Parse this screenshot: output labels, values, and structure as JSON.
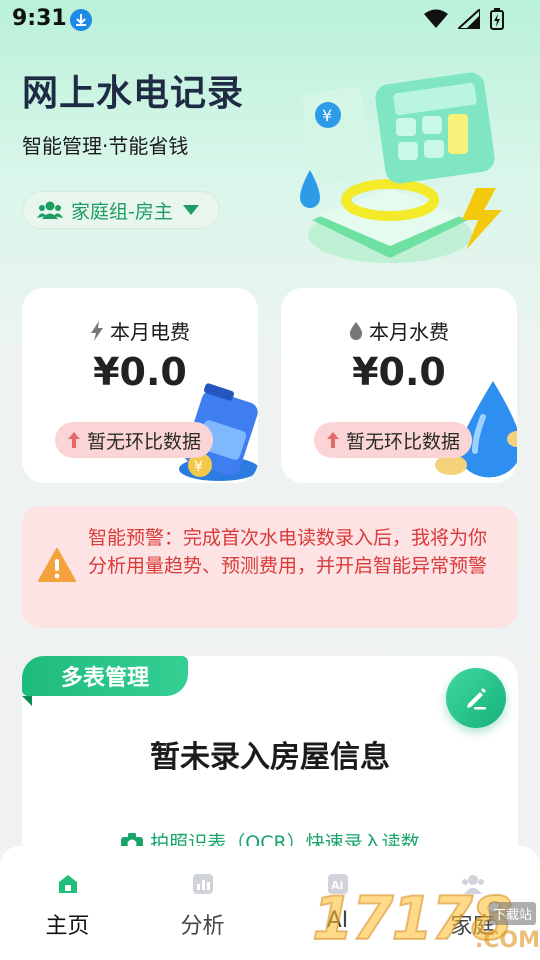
{
  "status_bar": {
    "time": "9:31"
  },
  "header": {
    "title": "网上水电记录",
    "subtitle": "智能管理·节能省钱",
    "family_selector": "家庭组-房主"
  },
  "fee_cards": {
    "electricity": {
      "label": "本月电费",
      "value": "¥0.0",
      "badge": "暂无环比数据"
    },
    "water": {
      "label": "本月水费",
      "value": "¥0.0",
      "badge": "暂无环比数据"
    }
  },
  "warning": {
    "text": "智能预警：完成首次水电读数录入后，我将为你分析用量趋势、预测费用，并开启智能异常预警"
  },
  "meter_section": {
    "tag": "多表管理",
    "empty_title": "暂未录入房屋信息",
    "ocr_link": "拍照识表（OCR）快速录入读数"
  },
  "nav": {
    "items": [
      {
        "label": "主页",
        "icon": "home-icon",
        "active": true
      },
      {
        "label": "分析",
        "icon": "chart-icon",
        "active": false
      },
      {
        "label": "AI",
        "icon": "ai-icon",
        "active": false
      },
      {
        "label": "家庭",
        "icon": "family-icon",
        "active": false
      }
    ]
  },
  "watermark": {
    "number": "17178",
    "site": "下载站",
    "domain": ".COM"
  },
  "colors": {
    "accent": "#1d9d62",
    "warning_bg": "#fde3e3",
    "warning_text": "#d93b3b",
    "badge_bg": "#fbd5d5"
  }
}
